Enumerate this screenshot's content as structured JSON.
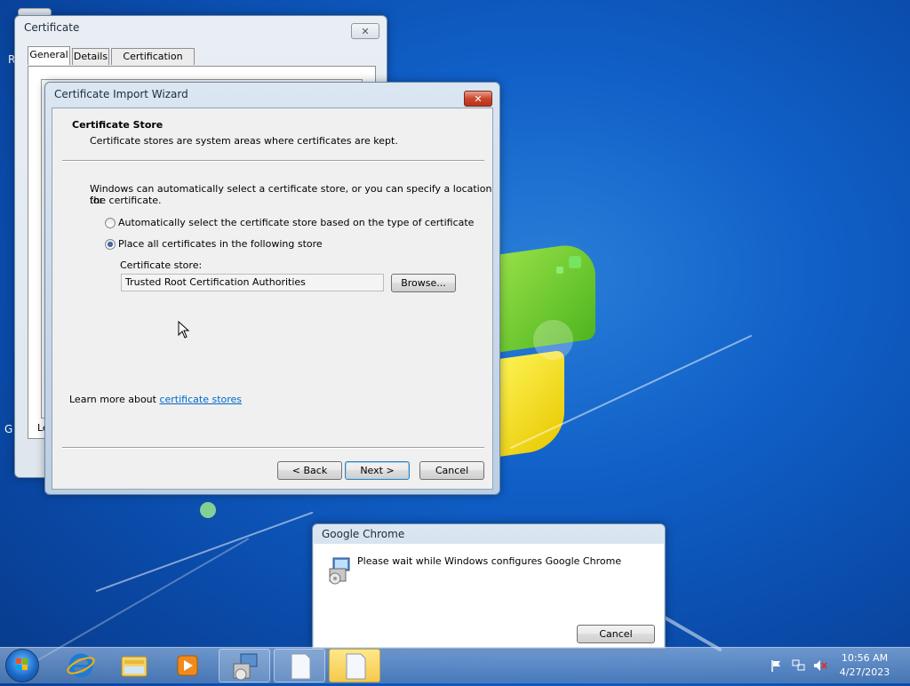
{
  "desktop": {
    "left_fragment": "R",
    "left_fragment2": "G"
  },
  "certificate_window": {
    "title": "Certificate",
    "tabs": [
      {
        "label": "General",
        "active": true
      },
      {
        "label": "Details",
        "active": false
      },
      {
        "label": "Certification Path",
        "active": false
      }
    ],
    "partial_text": "Le"
  },
  "wizard": {
    "title": "Certificate Import Wizard",
    "header_title": "Certificate Store",
    "header_subtitle": "Certificate stores are system areas where certificates are kept.",
    "intro_line1": "Windows can automatically select a certificate store, or you can specify a location for",
    "intro_line2": "the certificate.",
    "option_auto": "Automatically select the certificate store based on the type of certificate",
    "option_manual": "Place all certificates in the following store",
    "selected_option": "manual",
    "store_label": "Certificate store:",
    "store_value": "Trusted Root Certification Authorities",
    "browse_label": "Browse...",
    "learn_prefix": "Learn more about ",
    "learn_link": "certificate stores",
    "back_label": "< Back",
    "next_label": "Next >",
    "cancel_label": "Cancel"
  },
  "chrome_dialog": {
    "title": "Google Chrome",
    "message": "Please wait while Windows configures Google Chrome",
    "cancel_label": "Cancel"
  },
  "taskbar": {
    "items": [
      {
        "name": "internet-explorer-icon"
      },
      {
        "name": "file-explorer-icon"
      },
      {
        "name": "media-player-icon"
      },
      {
        "name": "installer-icon"
      },
      {
        "name": "document-icon"
      },
      {
        "name": "document-icon",
        "active": true
      }
    ],
    "clock_time": "10:56 AM",
    "clock_date": "4/27/2023"
  }
}
